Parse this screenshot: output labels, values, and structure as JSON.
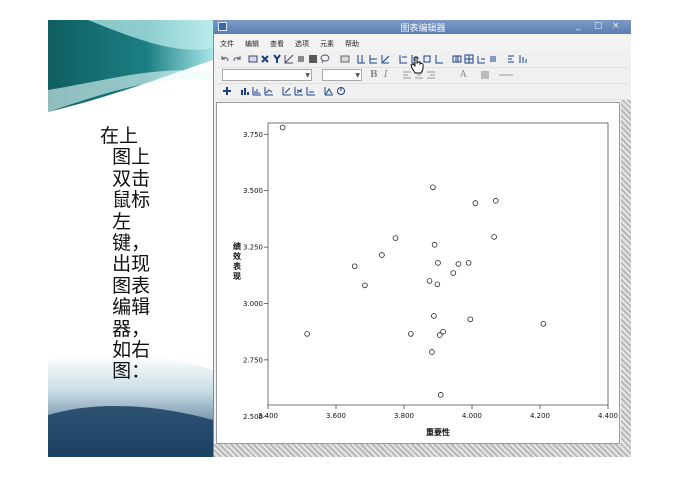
{
  "slide": {
    "text": "在上\n  图上\n  双击\n  鼠标\n  左\n  键，\n  出现\n  图表\n  编辑\n  器，\n  如右\n  图："
  },
  "window": {
    "title": "图表编辑器",
    "controls": {
      "minimize": "_",
      "maximize": "□",
      "close": "×"
    }
  },
  "menu": {
    "items": [
      {
        "name": "menu-file",
        "label": "文件"
      },
      {
        "name": "menu-edit",
        "label": "编辑"
      },
      {
        "name": "menu-view",
        "label": "查看"
      },
      {
        "name": "menu-options",
        "label": "选项"
      },
      {
        "name": "menu-elements",
        "label": "元素"
      },
      {
        "name": "menu-help",
        "label": "帮助"
      }
    ]
  },
  "toolbar": {
    "bold": "B",
    "italic": "I",
    "text_color_label": "A"
  },
  "chart_data": {
    "type": "scatter",
    "xlabel": "重要性",
    "ylabel": "绩效表现",
    "xlim": [
      3.4,
      4.4
    ],
    "ylim": [
      2.55,
      3.8
    ],
    "xticks": [
      "3.400",
      "3.600",
      "3.800",
      "4.000",
      "4.200",
      "4.400"
    ],
    "yticks": [
      "2.500",
      "2.750",
      "3.000",
      "3.250",
      "3.500",
      "3.750"
    ],
    "ytick_values": [
      2.5,
      2.75,
      3.0,
      3.25,
      3.5,
      3.75
    ],
    "xtick_values": [
      3.4,
      3.6,
      3.8,
      4.0,
      4.2,
      4.4
    ],
    "grid": false,
    "points": [
      {
        "x": 3.443,
        "y": 3.78
      },
      {
        "x": 3.515,
        "y": 2.865
      },
      {
        "x": 3.655,
        "y": 3.165
      },
      {
        "x": 3.685,
        "y": 3.08
      },
      {
        "x": 3.735,
        "y": 3.215
      },
      {
        "x": 3.775,
        "y": 3.29
      },
      {
        "x": 3.82,
        "y": 2.865
      },
      {
        "x": 3.875,
        "y": 3.1
      },
      {
        "x": 3.882,
        "y": 2.785
      },
      {
        "x": 3.885,
        "y": 3.515
      },
      {
        "x": 3.888,
        "y": 2.945
      },
      {
        "x": 3.89,
        "y": 3.26
      },
      {
        "x": 3.898,
        "y": 3.085
      },
      {
        "x": 3.9,
        "y": 3.18
      },
      {
        "x": 3.905,
        "y": 2.86
      },
      {
        "x": 3.908,
        "y": 2.595
      },
      {
        "x": 3.915,
        "y": 2.875
      },
      {
        "x": 3.945,
        "y": 3.135
      },
      {
        "x": 3.96,
        "y": 3.175
      },
      {
        "x": 3.99,
        "y": 3.18
      },
      {
        "x": 3.995,
        "y": 2.93
      },
      {
        "x": 4.01,
        "y": 3.445
      },
      {
        "x": 4.065,
        "y": 3.295
      },
      {
        "x": 4.07,
        "y": 3.455
      },
      {
        "x": 4.21,
        "y": 2.91
      }
    ]
  }
}
